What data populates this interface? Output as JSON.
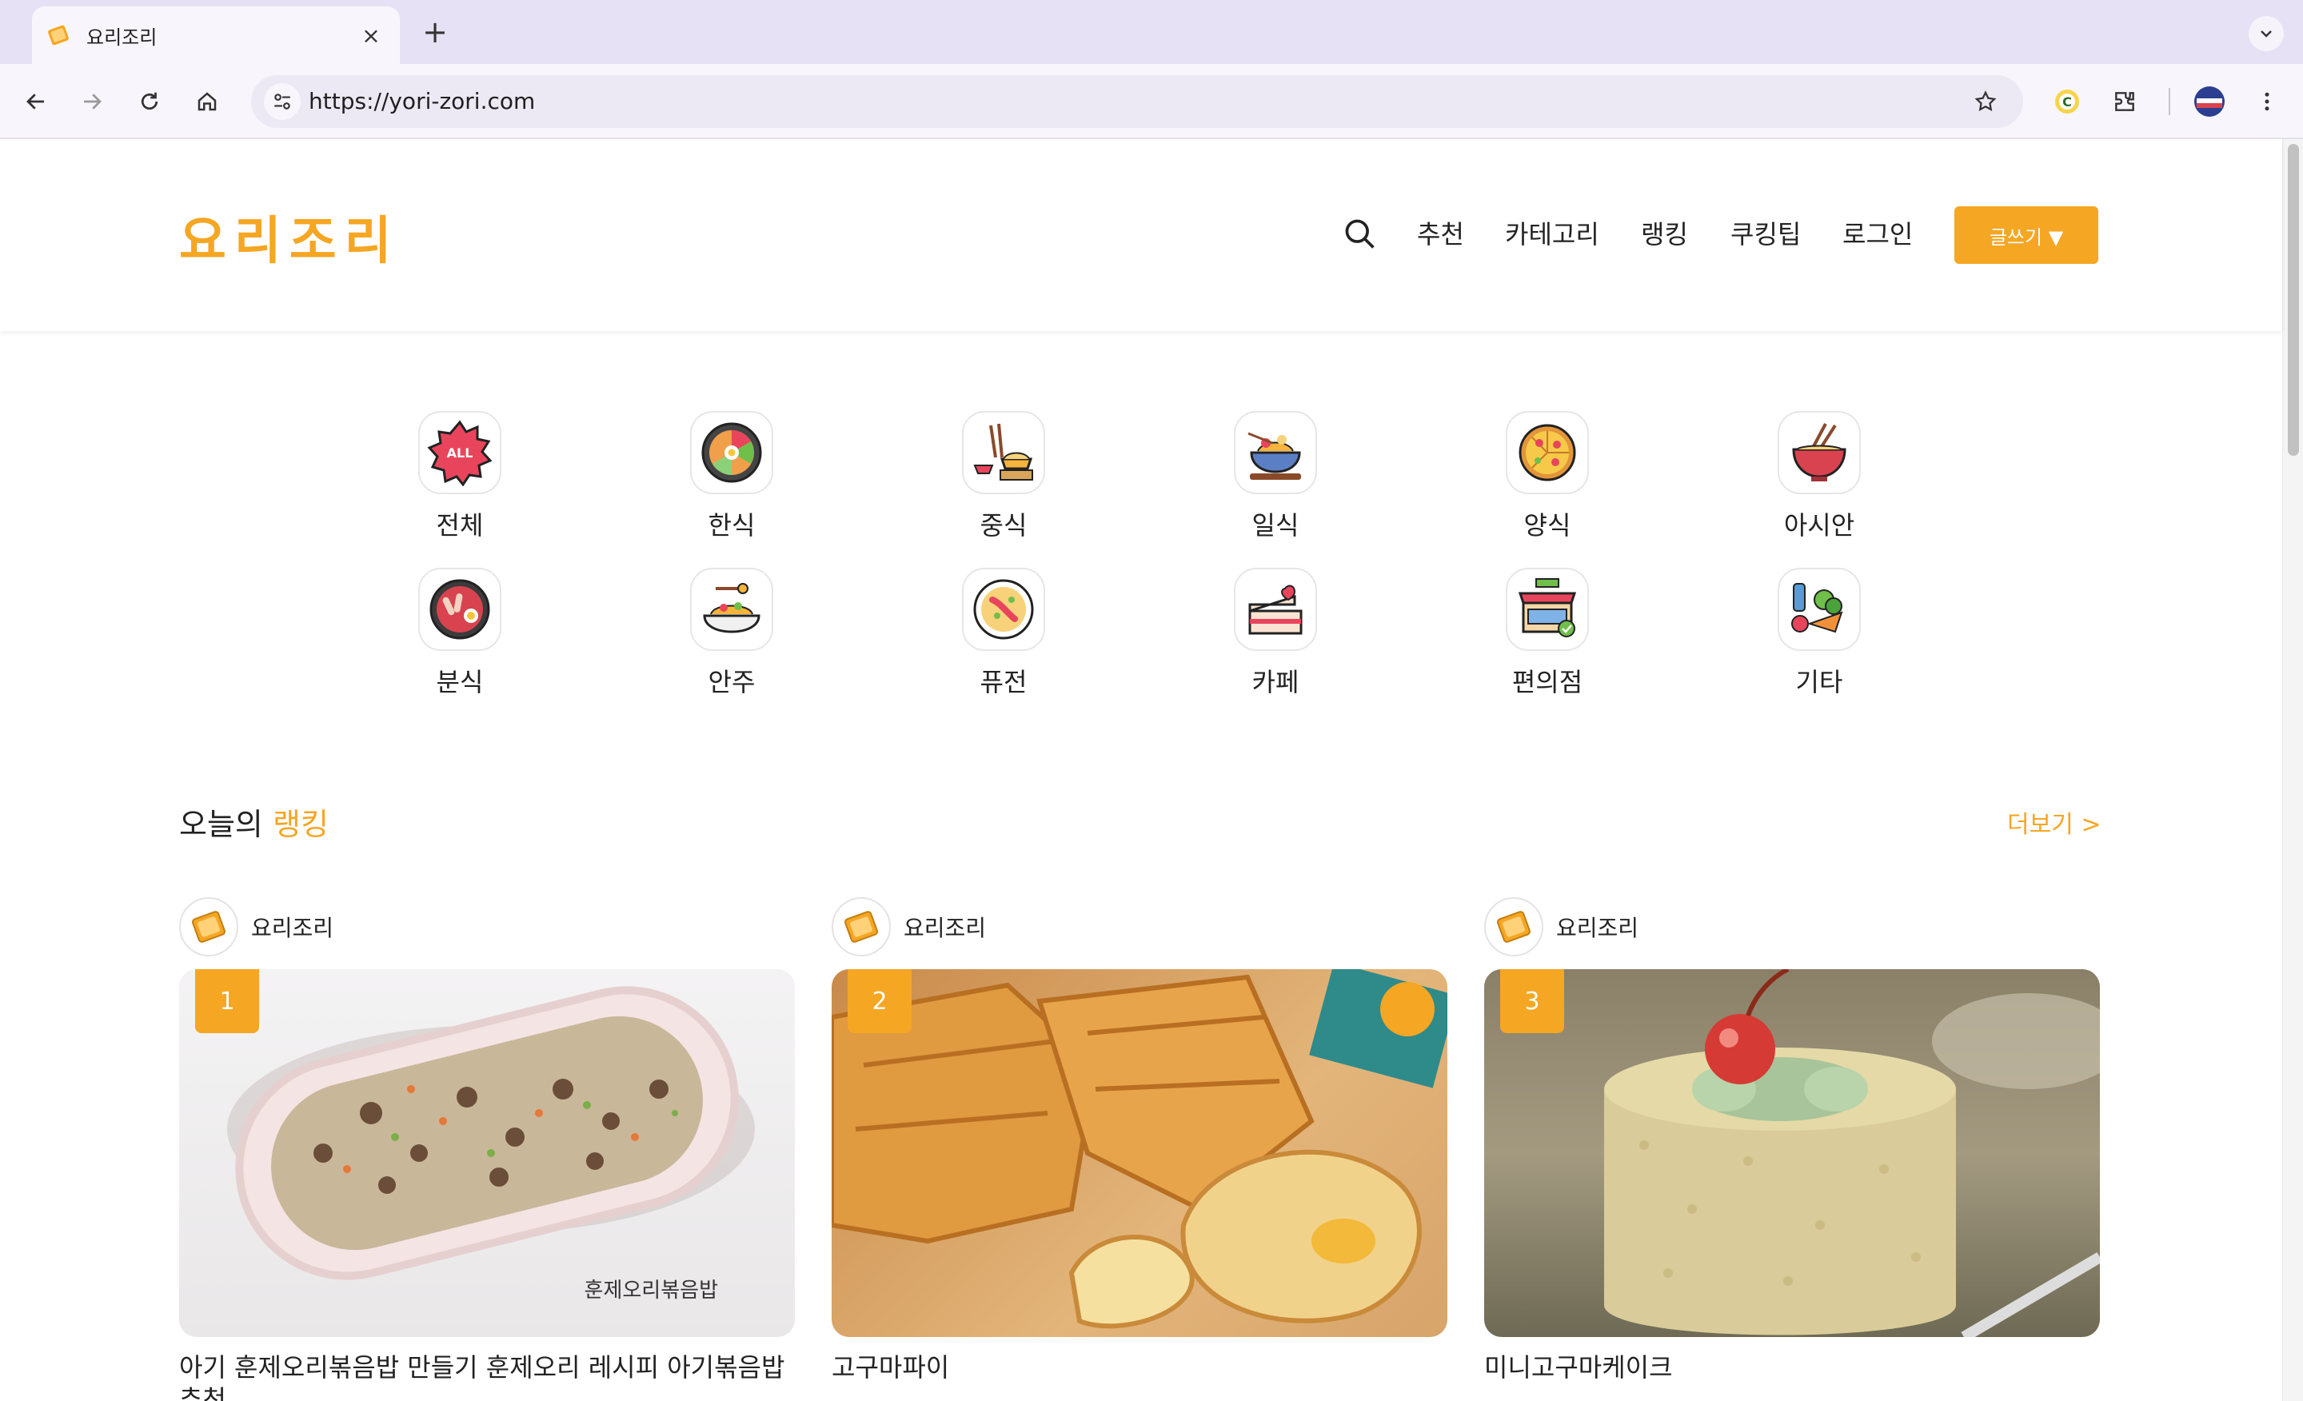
{
  "browser": {
    "tab_title": "요리조리",
    "url": "https://yori-zori.com",
    "new_tab_symbol": "+",
    "close_symbol": "×"
  },
  "site": {
    "logo": "요리조리",
    "nav": [
      "추천",
      "카테고리",
      "랭킹",
      "쿠킹팁",
      "로그인"
    ],
    "write_button": "글쓰기 ▼",
    "accent_color": "#f5a623"
  },
  "categories": [
    {
      "label": "전체",
      "icon": "all-badge-icon"
    },
    {
      "label": "한식",
      "icon": "bibimbap-icon"
    },
    {
      "label": "중식",
      "icon": "chinese-food-icon"
    },
    {
      "label": "일식",
      "icon": "japanese-food-icon"
    },
    {
      "label": "양식",
      "icon": "pizza-icon"
    },
    {
      "label": "아시안",
      "icon": "noodle-bowl-icon"
    },
    {
      "label": "분식",
      "icon": "tteokbokki-icon"
    },
    {
      "label": "안주",
      "icon": "snack-plate-icon"
    },
    {
      "label": "퓨전",
      "icon": "fusion-dish-icon"
    },
    {
      "label": "카페",
      "icon": "cake-slice-icon"
    },
    {
      "label": "편의점",
      "icon": "convenience-store-icon"
    },
    {
      "label": "기타",
      "icon": "grocery-icon"
    }
  ],
  "ranking": {
    "title_prefix": "오늘의",
    "title_accent": "랭킹",
    "more": "더보기 >",
    "items": [
      {
        "rank": "1",
        "author": "요리조리",
        "title": "아기 훈제오리볶음밥 만들기 훈제오리 레시피 아기볶음밥 추천",
        "image_caption": "훈제오리볶음밥"
      },
      {
        "rank": "2",
        "author": "요리조리",
        "title": "고구마파이",
        "image_caption": ""
      },
      {
        "rank": "3",
        "author": "요리조리",
        "title": "미니고구마케이크",
        "image_caption": ""
      }
    ]
  }
}
